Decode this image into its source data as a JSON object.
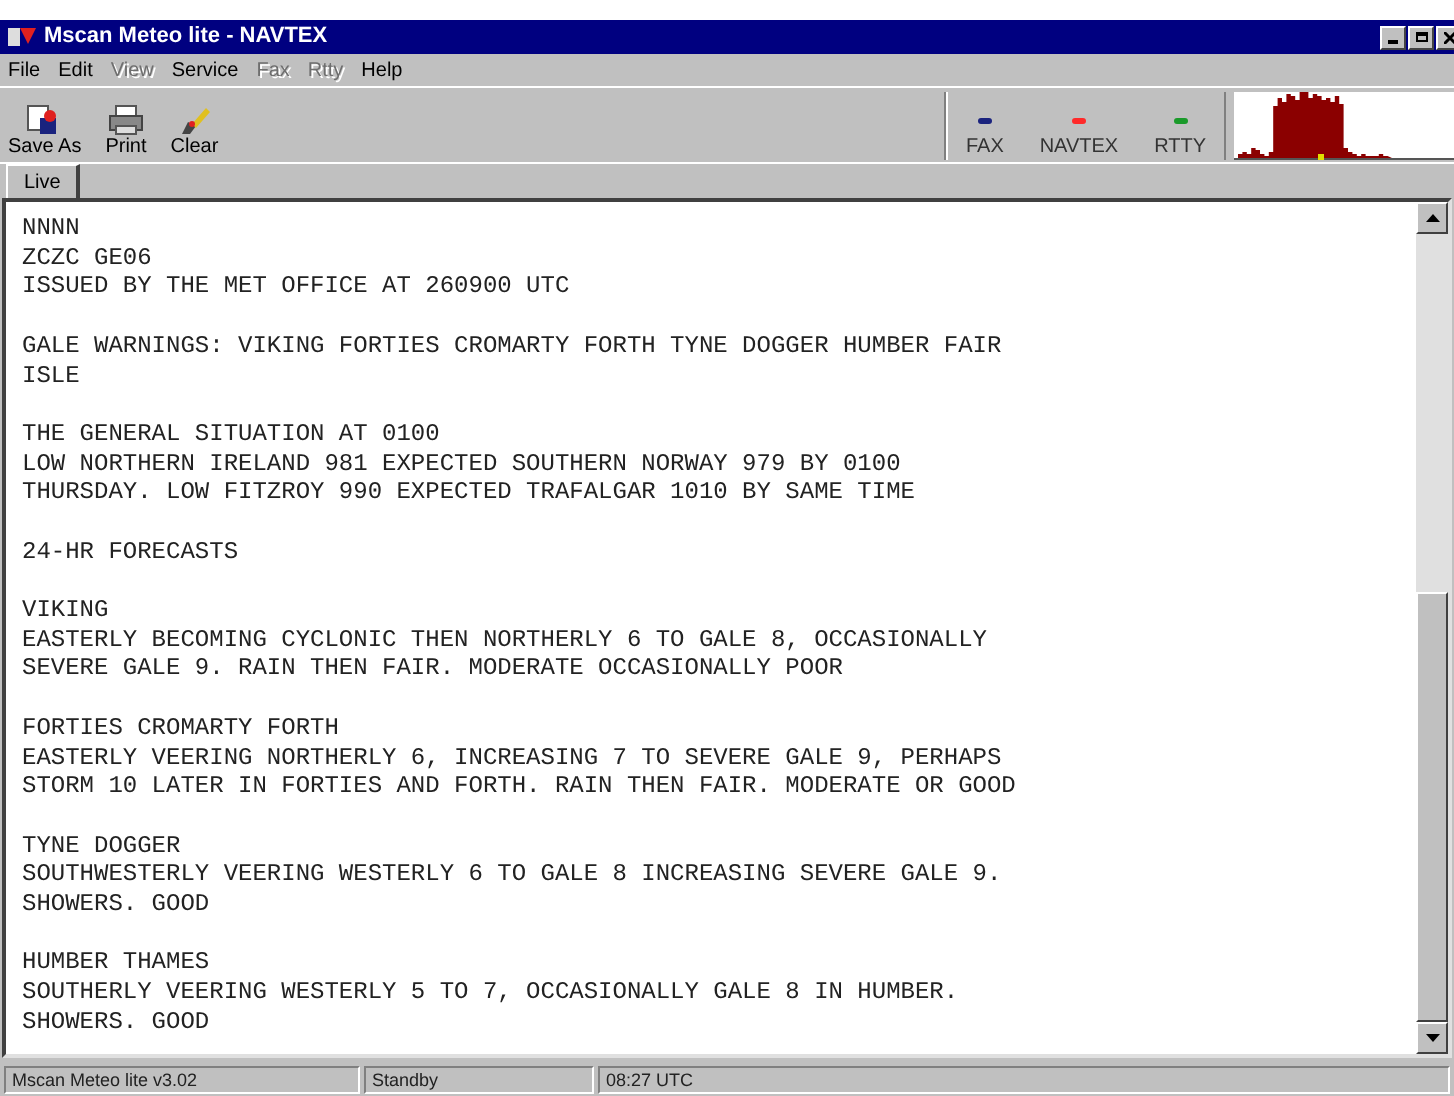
{
  "window": {
    "title": "Mscan Meteo lite - NAVTEX"
  },
  "menu": [
    {
      "label": "File",
      "disabled": false
    },
    {
      "label": "Edit",
      "disabled": false
    },
    {
      "label": "View",
      "disabled": true
    },
    {
      "label": "Service",
      "disabled": false
    },
    {
      "label": "Fax",
      "disabled": true
    },
    {
      "label": "Rtty",
      "disabled": true
    },
    {
      "label": "Help",
      "disabled": false
    }
  ],
  "toolbar": [
    {
      "label": "Save As",
      "kind": "save"
    },
    {
      "label": "Print",
      "kind": "print"
    },
    {
      "label": "Clear",
      "kind": "clear"
    }
  ],
  "modes": [
    {
      "label": "FAX",
      "color": "#1a237e"
    },
    {
      "label": "NAVTEX",
      "color": "#ff2a2a"
    },
    {
      "label": "RTTY",
      "color": "#1a9a2a"
    }
  ],
  "tabs": [
    {
      "label": "Live",
      "selected": true
    }
  ],
  "message": [
    [
      "NNNN",
      "ZCZC GE06",
      "ISSUED BY THE MET OFFICE AT 260900 UTC"
    ],
    [
      "GALE WARNINGS: VIKING FORTIES CROMARTY FORTH TYNE DOGGER HUMBER FAIR",
      "ISLE"
    ],
    [
      "THE GENERAL SITUATION AT 0100",
      "LOW NORTHERN IRELAND 981 EXPECTED SOUTHERN NORWAY 979 BY 0100",
      "THURSDAY. LOW FITZROY 990 EXPECTED TRAFALGAR 1010 BY SAME TIME"
    ],
    [
      "24-HR FORECASTS"
    ],
    [
      "VIKING",
      "EASTERLY BECOMING CYCLONIC THEN NORTHERLY 6 TO GALE 8, OCCASIONALLY",
      "SEVERE GALE 9. RAIN THEN FAIR. MODERATE OCCASIONALLY POOR"
    ],
    [
      "FORTIES CROMARTY FORTH",
      "EASTERLY VEERING NORTHERLY 6, INCREASING 7 TO SEVERE GALE 9, PERHAPS",
      "STORM 10 LATER IN FORTIES AND FORTH. RAIN THEN FAIR. MODERATE OR GOOD"
    ],
    [
      "TYNE DOGGER",
      "SOUTHWESTERLY VEERING WESTERLY 6 TO GALE 8 INCREASING SEVERE GALE 9.",
      "SHOWERS. GOOD"
    ],
    [
      "HUMBER THAMES",
      "SOUTHERLY VEERING WESTERLY 5 TO 7, OCCASIONALLY GALE 8 IN HUMBER.",
      "SHOWERS. GOOD"
    ]
  ],
  "status_bar": [
    "Mscan Meteo lite v3.02",
    "Standby",
    "08:27 UTC"
  ]
}
